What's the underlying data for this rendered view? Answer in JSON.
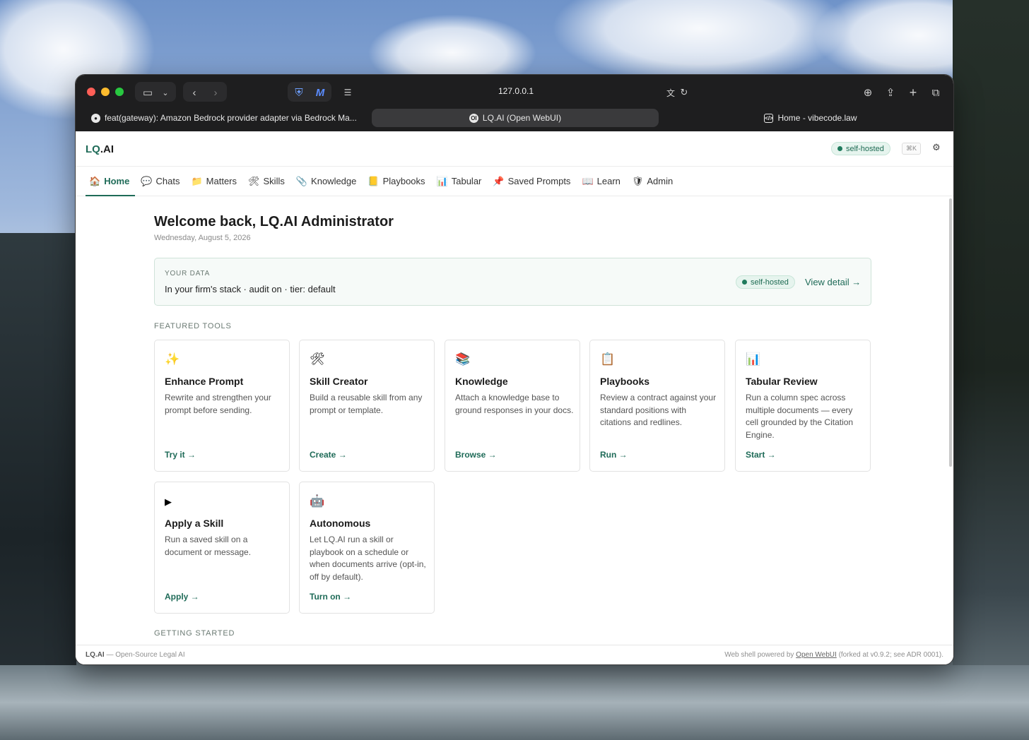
{
  "browser": {
    "url": "127.0.0.1",
    "tabs": [
      {
        "label": "feat(gateway): Amazon Bedrock provider adapter via Bedrock Ma..."
      },
      {
        "label": "LQ.AI (Open WebUI)"
      },
      {
        "label": "Home - vibecode.law"
      }
    ]
  },
  "app": {
    "brand_prefix": "LQ",
    "brand_suffix": ".AI",
    "status_pill": "self-hosted",
    "shortcut": "⌘K"
  },
  "nav": [
    {
      "label": "Home",
      "icon": "🏠"
    },
    {
      "label": "Chats",
      "icon": "💬"
    },
    {
      "label": "Matters",
      "icon": "📁"
    },
    {
      "label": "Skills",
      "icon": "🛠"
    },
    {
      "label": "Knowledge",
      "icon": "📎"
    },
    {
      "label": "Playbooks",
      "icon": "📒"
    },
    {
      "label": "Tabular",
      "icon": "📊"
    },
    {
      "label": "Saved Prompts",
      "icon": "📌"
    },
    {
      "label": "Learn",
      "icon": "📖"
    },
    {
      "label": "Admin",
      "icon": "🛡"
    }
  ],
  "home": {
    "welcome": "Welcome back, LQ.AI Administrator",
    "date": "Wednesday, August 5, 2026",
    "your_data": {
      "label": "YOUR DATA",
      "text": "In your firm's stack · audit on · tier: default",
      "pill": "self-hosted",
      "link": "View detail →"
    },
    "featured_label": "FEATURED TOOLS",
    "getting_started_label": "GETTING STARTED",
    "cards": [
      {
        "icon": "✨",
        "title": "Enhance Prompt",
        "desc": "Rewrite and strengthen your prompt before sending.",
        "link": "Try it →"
      },
      {
        "icon": "🛠",
        "title": "Skill Creator",
        "desc": "Build a reusable skill from any prompt or template.",
        "link": "Create →"
      },
      {
        "icon": "📚",
        "title": "Knowledge",
        "desc": "Attach a knowledge base to ground responses in your docs.",
        "link": "Browse →"
      },
      {
        "icon": "📋",
        "title": "Playbooks",
        "desc": "Review a contract against your standard positions with citations and redlines.",
        "link": "Run →"
      },
      {
        "icon": "📊",
        "title": "Tabular Review",
        "desc": "Run a column spec across multiple documents — every cell grounded by the Citation Engine.",
        "link": "Start →"
      },
      {
        "icon": "▶",
        "title": "Apply a Skill",
        "desc": "Run a saved skill on a document or message.",
        "link": "Apply →"
      },
      {
        "icon": "🤖",
        "title": "Autonomous",
        "desc": "Let LQ.AI run a skill or playbook on a schedule or when documents arrive (opt-in, off by default).",
        "link": "Turn on →"
      }
    ]
  },
  "footer": {
    "brand": "LQ.AI",
    "left": " — Open-Source Legal AI",
    "right_prefix": "Web shell powered by ",
    "right_link": "Open WebUI",
    "right_suffix": " (forked at v0.9.2; see ADR 0001)."
  }
}
